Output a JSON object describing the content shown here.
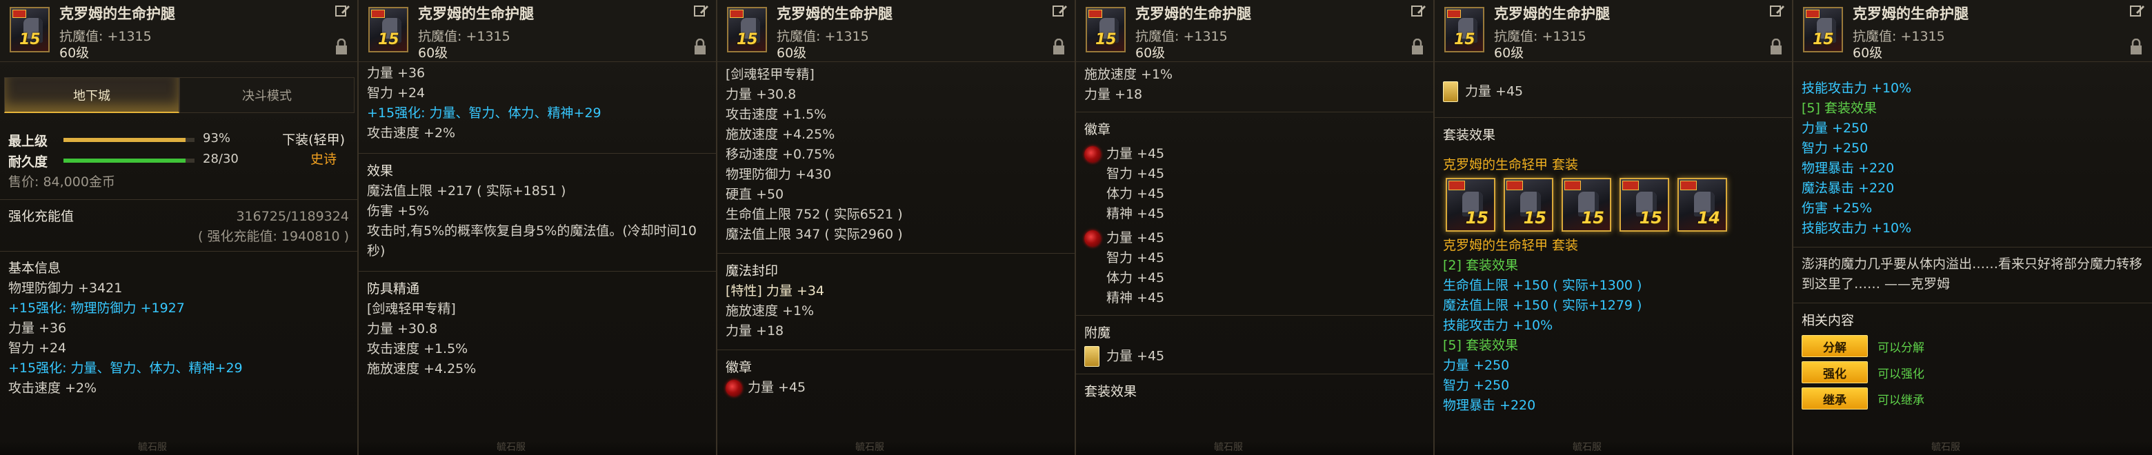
{
  "item": {
    "name": "克罗姆的生命护腿",
    "stat": "抗魔值: +1315",
    "level": "60级",
    "badge_level": "15"
  },
  "panel1": {
    "tabs": [
      "地下城",
      "决斗模式"
    ],
    "bars": [
      {
        "label": "最上级",
        "value": "93%",
        "fraction": 0.93,
        "color": "#e0b040"
      },
      {
        "label": "耐久度",
        "value": "28/30",
        "fraction": 0.933,
        "color": "#3fc438"
      }
    ],
    "slot": "下装(轻甲)",
    "rarity": "史诗",
    "price": "售价: 84,000金币",
    "charge_label": "强化充能值",
    "charge_value": "316725/1189324",
    "charge_sub": "( 强化充能值: 1940810 )",
    "basic_title": "基本信息",
    "lines": [
      {
        "text": "物理防御力 +3421",
        "style": ""
      },
      {
        "text": "+15强化: 物理防御力 +1927",
        "style": "cyan"
      },
      {
        "text": "力量 +36",
        "style": ""
      },
      {
        "text": "智力 +24",
        "style": ""
      },
      {
        "text": "+15强化: 力量、智力、体力、精神+29",
        "style": "cyan"
      },
      {
        "text": "攻击速度 +2%",
        "style": ""
      }
    ],
    "stamp": "毓石服"
  },
  "panel2": {
    "lines_top": [
      {
        "text": "力量 +36",
        "style": ""
      },
      {
        "text": "智力 +24",
        "style": ""
      },
      {
        "text": "+15强化: 力量、智力、体力、精神+29",
        "style": "cyan"
      },
      {
        "text": "攻击速度 +2%",
        "style": ""
      }
    ],
    "effect_title": "效果",
    "effect_lines": [
      "魔法值上限 +217 ( 实际+1851 )",
      "伤害 +5%",
      "攻击时,有5%的概率恢复自身5%的魔法值。(冷却时间10秒)"
    ],
    "mastery_title": "防具精通",
    "mastery_lines": [
      "[剑魂轻甲专精]",
      "力量 +30.8",
      "攻击速度 +1.5%",
      "施放速度 +4.25%"
    ],
    "stamp": "毓石服"
  },
  "panel3": {
    "lines": [
      "[剑魂轻甲专精]",
      "力量 +30.8",
      "攻击速度 +1.5%",
      "施放速度 +4.25%",
      "移动速度 +0.75%",
      "物理防御力 +430",
      "硬直 +50",
      "生命值上限 752 ( 实际6521 )",
      "魔法值上限 347 ( 实际2960 )"
    ],
    "seal_title": "魔法封印",
    "seal_lines": [
      {
        "text": "[特性] 力量 +34",
        "style": "hl"
      },
      {
        "text": "施放速度 +1%",
        "style": ""
      },
      {
        "text": "力量 +18",
        "style": ""
      }
    ],
    "emblem_title": "徽章",
    "emblem_line": "力量 +45",
    "stamp": "毓石服"
  },
  "panel4": {
    "top_lines": [
      "施放速度 +1%",
      "力量 +18"
    ],
    "emblem_title": "徽章",
    "emblem_groups": [
      [
        "力量 +45",
        "智力 +45",
        "体力 +45",
        "精神 +45"
      ],
      [
        "力量 +45",
        "智力 +45",
        "体力 +45",
        "精神 +45"
      ]
    ],
    "enchant_title": "附魔",
    "enchant_line": "力量 +45",
    "set_title": "套装效果",
    "stamp": "毓石服"
  },
  "panel5": {
    "card_line": "力量 +45",
    "set_title": "套装效果",
    "set_name": "克罗姆的生命轻甲 套装",
    "set_icon_levels": [
      "15",
      "15",
      "15",
      "15",
      "14"
    ],
    "set_name2": "克罗姆的生命轻甲 套装",
    "set_lines": [
      {
        "text": "[2] 套装效果",
        "style": "green"
      },
      {
        "text": "生命值上限 +150 ( 实际+1300 )",
        "style": "cyan"
      },
      {
        "text": "魔法值上限 +150 ( 实际+1279 )",
        "style": "cyan"
      },
      {
        "text": "技能攻击力 +10%",
        "style": "cyan"
      },
      {
        "text": "[5] 套装效果",
        "style": "green"
      },
      {
        "text": "力量 +250",
        "style": "cyan"
      },
      {
        "text": "智力 +250",
        "style": "cyan"
      },
      {
        "text": "物理暴击 +220",
        "style": "cyan"
      }
    ],
    "stamp": "毓石服"
  },
  "panel6": {
    "lines": [
      {
        "text": "技能攻击力 +10%",
        "style": "cyan"
      },
      {
        "text": "[5] 套装效果",
        "style": "green"
      },
      {
        "text": "力量 +250",
        "style": "cyan"
      },
      {
        "text": "智力 +250",
        "style": "cyan"
      },
      {
        "text": "物理暴击 +220",
        "style": "cyan"
      },
      {
        "text": "魔法暴击 +220",
        "style": "cyan"
      },
      {
        "text": "伤害 +25%",
        "style": "cyan"
      },
      {
        "text": "技能攻击力 +10%",
        "style": "cyan"
      }
    ],
    "flavor": "澎湃的魔力几乎要从体内溢出……看来只好将部分魔力转移到这里了…… ——克罗姆",
    "related_title": "相关内容",
    "related": [
      {
        "button": "分解",
        "text": "可以分解"
      },
      {
        "button": "强化",
        "text": "可以强化"
      },
      {
        "button": "继承",
        "text": "可以继承"
      }
    ],
    "stamp": "毓石服"
  }
}
